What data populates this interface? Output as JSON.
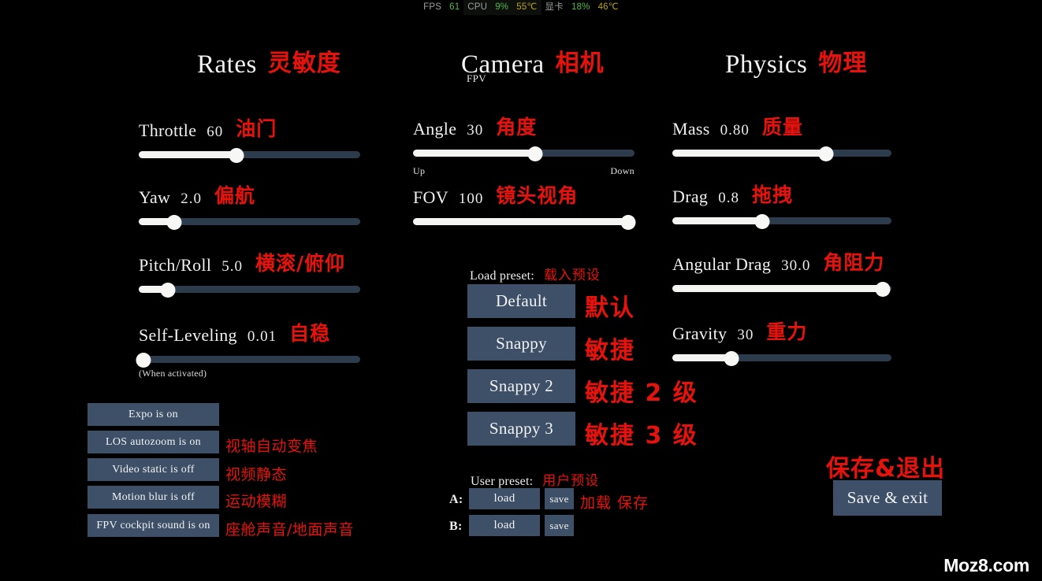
{
  "statusbar": {
    "fps_label": "FPS",
    "fps_value": "61",
    "cpu_label": "CPU",
    "cpu_usage": "9%",
    "cpu_temp": "55℃",
    "gpu_label": "显卡",
    "gpu_usage": "18%",
    "gpu_temp": "46℃"
  },
  "rates": {
    "title": "Rates",
    "title_cn": "灵敏度",
    "sliders": [
      {
        "label": "Throttle",
        "value": "60",
        "cn": "油门",
        "percent": 44
      },
      {
        "label": "Yaw",
        "value": "2.0",
        "cn": "偏航",
        "percent": 16
      },
      {
        "label": "Pitch/Roll",
        "value": "5.0",
        "cn": "横滚/俯仰",
        "percent": 13
      },
      {
        "label": "Self-Leveling",
        "value": "0.01",
        "cn": "自稳",
        "percent": 2
      }
    ],
    "self_leveling_note": "(When activated)",
    "toggles": [
      {
        "label": "Expo is on",
        "cn": ""
      },
      {
        "label": "LOS autozoom is on",
        "cn": "视轴自动变焦"
      },
      {
        "label": "Video static is off",
        "cn": "视频静态"
      },
      {
        "label": "Motion blur is off",
        "cn": "运动模糊"
      },
      {
        "label": "FPV cockpit sound is on",
        "cn": "座舱声音/地面声音"
      }
    ]
  },
  "camera": {
    "title": "Camera",
    "title_cn": "相机",
    "subtitle": "FPV",
    "sliders": [
      {
        "label": "Angle",
        "value": "30",
        "cn": "角度",
        "percent": 55
      },
      {
        "label": "FOV",
        "value": "100",
        "cn": "镜头视角",
        "percent": 97
      }
    ],
    "angle_min_label": "Up",
    "angle_max_label": "Down",
    "load_preset_label": "Load preset:",
    "load_preset_cn": "载入预设",
    "presets": [
      {
        "label": "Default",
        "cn": "默认"
      },
      {
        "label": "Snappy",
        "cn": "敏捷"
      },
      {
        "label": "Snappy 2",
        "cn": "敏捷 2 级"
      },
      {
        "label": "Snappy 3",
        "cn": "敏捷 3 级"
      }
    ],
    "user_preset_label": "User preset:",
    "user_preset_cn": "用户预设",
    "user_rows": [
      {
        "slot": "A:",
        "load_label": "load",
        "save_label": "save"
      },
      {
        "slot": "B:",
        "load_label": "load",
        "save_label": "save"
      }
    ],
    "user_row_cn": "加载  保存"
  },
  "physics": {
    "title": "Physics",
    "title_cn": "物理",
    "sliders": [
      {
        "label": "Mass",
        "value": "0.80",
        "cn": "质量",
        "percent": 70
      },
      {
        "label": "Drag",
        "value": "0.8",
        "cn": "拖拽",
        "percent": 41
      },
      {
        "label": "Angular Drag",
        "value": "30.0",
        "cn": "角阻力",
        "percent": 96
      },
      {
        "label": "Gravity",
        "value": "30",
        "cn": "重力",
        "percent": 27
      }
    ]
  },
  "footer": {
    "save_exit_label": "Save & exit",
    "save_exit_cn": "保存&退出",
    "watermark": "Moz8.com"
  },
  "colors": {
    "accent_red": "#e8120c",
    "button_bg": "#3d5068",
    "track_empty": "#2c3c4c",
    "track_fill": "#f4f4f2",
    "status_green": "#52b84a",
    "status_temp": "#b9a21a"
  }
}
